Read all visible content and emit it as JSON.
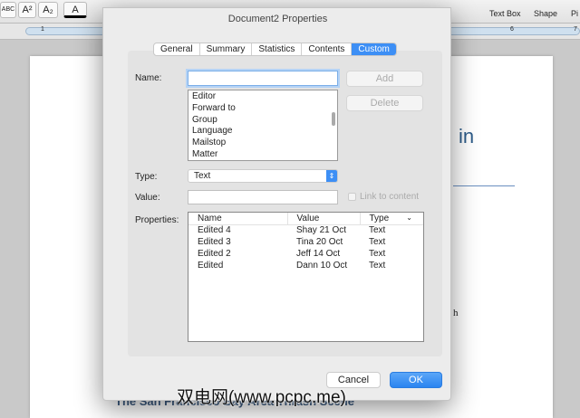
{
  "ribbon": {
    "text_box": "Text Box",
    "shape": "Shape",
    "picture": "Pi",
    "superscript": "A²",
    "subscript": "A₂",
    "abc": "ABC"
  },
  "ruler": {
    "mark1": "1",
    "mark6": "6",
    "mark7": "7"
  },
  "document": {
    "heading_fragment": "in",
    "body_fragment": "h",
    "subheading": "The San Francisco Bay Area Thrash Scene"
  },
  "dialog": {
    "title": "Document2 Properties",
    "tabs": [
      "General",
      "Summary",
      "Statistics",
      "Contents",
      "Custom"
    ],
    "active_tab": "Custom",
    "name_label": "Name:",
    "name_value": "",
    "add": "Add",
    "delete": "Delete",
    "name_options": [
      "Editor",
      "Forward to",
      "Group",
      "Language",
      "Mailstop",
      "Matter"
    ],
    "type_label": "Type:",
    "type_value": "Text",
    "value_label": "Value:",
    "value_value": "",
    "link_to_content": "Link to content",
    "properties_label": "Properties:",
    "columns": [
      "Name",
      "Value",
      "Type"
    ],
    "rows": [
      [
        "Edited 4",
        "Shay 21 Oct",
        "Text"
      ],
      [
        "Edited 3",
        "Tina 20 Oct",
        "Text"
      ],
      [
        "Edited 2",
        "Jeff 14 Oct",
        "Text"
      ],
      [
        "Edited",
        "Dann 10 Oct",
        "Text"
      ]
    ],
    "cancel": "Cancel",
    "ok": "OK"
  },
  "watermark": "双电网(www.pcpc.me)"
}
